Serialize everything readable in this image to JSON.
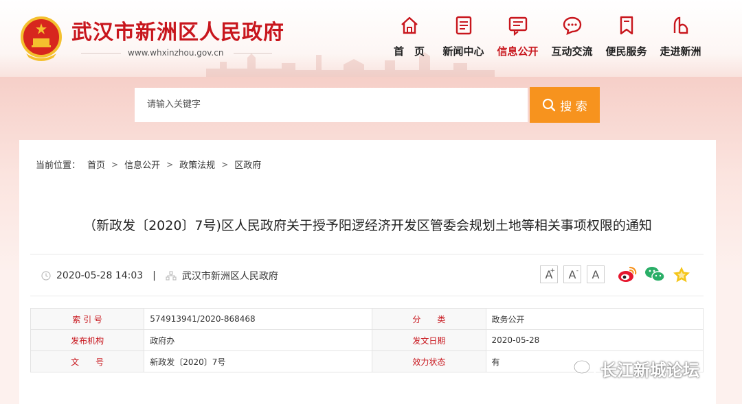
{
  "header": {
    "site_title": "武汉市新洲区人民政府",
    "site_url": "www.whxinzhou.gov.cn",
    "brand_color": "#c8161d",
    "nav": [
      {
        "label": "首　页",
        "icon": "home-icon"
      },
      {
        "label": "新闻中心",
        "icon": "news-icon"
      },
      {
        "label": "信息公开",
        "icon": "info-icon",
        "active": true
      },
      {
        "label": "互动交流",
        "icon": "chat-icon"
      },
      {
        "label": "便民服务",
        "icon": "bookmark-icon"
      },
      {
        "label": "走进新洲",
        "icon": "landmark-icon"
      }
    ]
  },
  "search": {
    "placeholder": "请输入关键字",
    "button_label": "搜 索",
    "button_color": "#f7931e"
  },
  "breadcrumb": {
    "prefix": "当前位置：",
    "items": [
      "首页",
      "信息公开",
      "政策法规",
      "区政府"
    ],
    "separator": ">"
  },
  "article": {
    "title": "（新政发〔2020〕7号)区人民政府关于授予阳逻经济开发区管委会规划土地等相关事项权限的通知",
    "date": "2020-05-28 14:03",
    "pipe": "|",
    "source": "武汉市新洲区人民政府"
  },
  "tools": {
    "font_buttons": [
      "A",
      "A",
      "A"
    ],
    "font_sup": [
      "+",
      "-"
    ]
  },
  "info_table": [
    [
      "索 引 号",
      "574913941/2020-868468",
      "分　　类",
      "政务公开"
    ],
    [
      "发布机构",
      "政府办",
      "发文日期",
      "2020-05-28"
    ],
    [
      "文　　号",
      "新政发〔2020〕7号",
      "效力状态",
      "有"
    ]
  ],
  "watermark": "长江新城论坛"
}
